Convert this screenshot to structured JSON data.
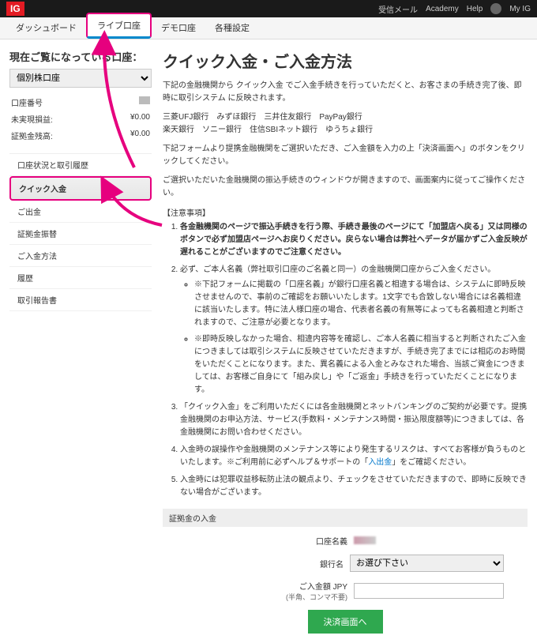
{
  "topbar": {
    "logo": "IG",
    "links": [
      "受信メール",
      "Academy",
      "Help"
    ],
    "myig": "My IG"
  },
  "nav": {
    "items": [
      "ダッシュボード",
      "ライブ口座",
      "デモ口座",
      "各種設定"
    ],
    "active_index": 1
  },
  "sidebar": {
    "title": "現在ご覧になっている口座：",
    "select_value": "個別株口座",
    "rows": [
      {
        "label": "口座番号",
        "value": ""
      },
      {
        "label": "未実現損益:",
        "value": "¥0.00"
      },
      {
        "label": "証拠金残高:",
        "value": "¥0.00"
      }
    ],
    "menu": [
      "口座状況と取引履歴",
      "クイック入金",
      "ご出金",
      "証拠金振替",
      "ご入金方法",
      "履歴",
      "取引報告書"
    ],
    "highlight_index": 1
  },
  "content": {
    "h1": "クイック入金・ご入金方法",
    "intro1": "下記の金融機関から クイック入金 でご入金手続きを行っていただくと、お客さまの手続き完了後、即時に取引システム に反映されます。",
    "banks_line1": "三菱UFJ銀行　みずほ銀行　三井住友銀行　PayPay銀行",
    "banks_line2": "楽天銀行　ソニー銀行　住信SBIネット銀行　ゆうちょ銀行",
    "intro2": "下記フォームより提携金融機関をご選択いただき、ご入金額を入力の上「決済画面へ」のボタンをクリックしてください。",
    "intro3": "ご選択いただいた金融機関の振込手続きのウィンドウが開きますので、画面案内に従ってご操作ください。",
    "note_title": "【注意事項】",
    "notes": [
      {
        "text_bold": "各金融機関のページで振込手続きを行う際、手続き最後のページにて「加盟店へ戻る」又は同様のボタンで必ず加盟店ページへお戻りください。戻らない場合は弊社へデータが届かずご入金反映が遅れることがございますのでご注意ください。"
      },
      {
        "text": "必ず、ご本人名義（弊社取引口座のご名義と同一）の金融機関口座からご入金ください。",
        "sub": [
          "※下記フォームに掲載の「口座名義」が銀行口座名義と相違する場合は、システムに即時反映させませんので、事前のご確認をお願いいたします。1文字でも合致しない場合には名義相違に該当いたします。特に法人様口座の場合、代表者名義の有無等によっても名義相違と判断されますので、ご注意が必要となります。",
          "※即時反映しなかった場合、相違内容等を確認し、ご本人名義に相当すると判断されたご入金につきましては取引システムに反映させていただきますが、手続き完了までには相応のお時間をいただくことになります。また、異名義による入金とみなされた場合、当該ご資金につきましては、お客様ご自身にて「組み戻し」や「ご返金」手続きを行っていただくことになります。"
        ]
      },
      {
        "text": "「クイック入金」をご利用いただくには各金融機関とネットバンキングのご契約が必要です。提携金融機関のお申込方法、サービス(手数料・メンテナンス時間・振込限度額等)につきましては、各金融機関にお問い合わせください。"
      },
      {
        "text_pre": "入金時の誤操作や金融機関のメンテナンス等により発生するリスクは、すべてお客様が負うものといたします。※ご利用前に必ずヘルプ＆サポートの「",
        "link": "入出金",
        "text_post": "」をご確認ください。"
      },
      {
        "text": "入金時には犯罪収益移転防止法の観点より、チェックをさせていただきますので、即時に反映できない場合がございます。"
      }
    ],
    "section_bar": "証拠金の入金",
    "form": {
      "name_label": "口座名義",
      "bank_label": "銀行名",
      "bank_placeholder": "お選び下さい",
      "amount_label": "ご入金額 JPY",
      "amount_sub": "(半角、コンマ不要)",
      "submit": "決済画面へ"
    }
  }
}
